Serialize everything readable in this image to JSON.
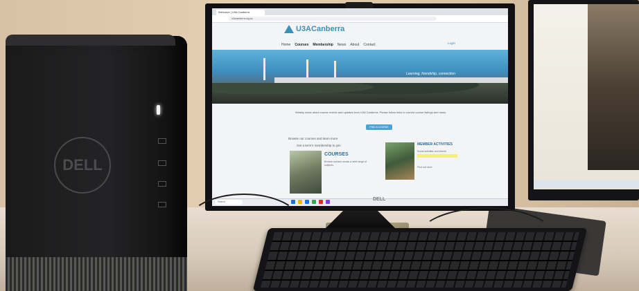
{
  "photo": {
    "tower_logo": "DELL",
    "monitor_logo": "DELL"
  },
  "browser": {
    "tab_title": "Welcome | U3A Canberra",
    "address": "u3acanberra.org.au"
  },
  "website": {
    "logo_text": "U3ACanberra",
    "nav": [
      "Home",
      "Courses",
      "Membership",
      "News",
      "About",
      "Contact"
    ],
    "login": "Login",
    "tagline": "Learning, friendship, connection",
    "welcome_text": "Weekly news about course events and updates from U3A Canberra. Please follow links to current course listings and news.",
    "cta_label": "FIND A COURSE",
    "line1": "Browse our courses and learn more",
    "line2": "Get a term's membership to join",
    "courses_title": "COURSES",
    "courses_text": "Browse courses across a wide range of subjects.",
    "activities_title": "MEMBER ACTIVITIES",
    "activities_text": "Social activities and events",
    "activities_more": "Find out more"
  },
  "taskbar": {
    "search_label": "Search"
  }
}
